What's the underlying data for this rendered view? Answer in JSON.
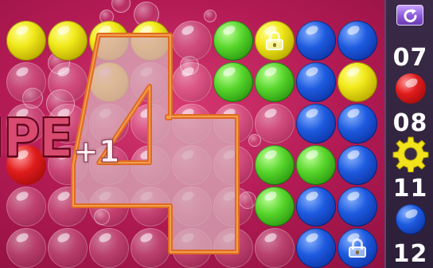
{
  "overlay": {
    "big_number": "4",
    "combo_word": "IPE",
    "bonus": "+1"
  },
  "sidebar": {
    "restart_icon": "restart-icon",
    "counters": [
      {
        "value": "07",
        "icon": "red-ball",
        "icon_color": "#e01c1c"
      },
      {
        "value": "08",
        "icon": "gear-icon",
        "icon_color": "#f2e21c"
      },
      {
        "value": "11",
        "icon": "blue-ball",
        "icon_color": "#1e5be0"
      },
      {
        "value": "12"
      }
    ]
  },
  "board": {
    "columns": 9,
    "rows": 6,
    "grid": [
      [
        "yellow",
        "yellow",
        "yellow",
        "yellow",
        "empty",
        "green",
        "yellow-lock",
        "blue",
        "blue"
      ],
      [
        "empty",
        "empty",
        "yellow",
        "empty",
        "empty",
        "green",
        "green",
        "blue",
        "yellow"
      ],
      [
        "empty",
        "empty",
        "empty",
        "empty",
        "empty",
        "empty",
        "empty",
        "blue",
        "blue"
      ],
      [
        "red",
        "empty",
        "empty",
        "empty",
        "empty",
        "empty",
        "green",
        "green",
        "blue"
      ],
      [
        "empty",
        "empty",
        "empty",
        "empty",
        "empty",
        "empty",
        "green",
        "blue",
        "blue"
      ],
      [
        "empty",
        "empty",
        "empty",
        "empty",
        "empty",
        "empty",
        "empty",
        "blue",
        "blue-lock"
      ]
    ]
  },
  "colors": {
    "background": "#b41b55",
    "sidebar": "#2c1f38",
    "yellow": "#f2ea1c",
    "green": "#58d62c",
    "blue": "#1e5be0",
    "red": "#e01c1c",
    "overlay_fill": "#c88c9e",
    "overlay_stroke": "#e06a20"
  }
}
